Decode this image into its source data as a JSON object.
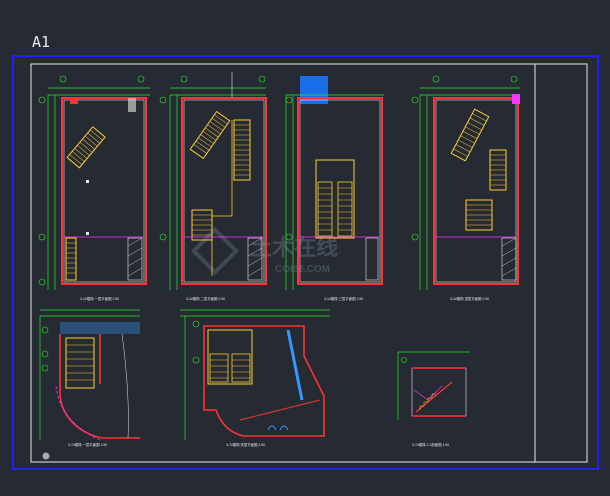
{
  "sheet": {
    "size_label": "A1"
  },
  "drawings": {
    "plan_1_caption": "3-1#楼梯 一层平面图 1:50",
    "plan_2_caption": "3-1#楼梯 二层平面图 1:50",
    "plan_3_caption": "3-1#楼梯 三层平面图 1:50",
    "plan_4_caption": "3-1#楼梯 顶层平面图 1:50",
    "plan_5_caption": "3-7#楼梯 一层平面图 1:50",
    "plan_6_caption": "3-7#楼梯 夹层平面图 1:50",
    "plan_7_caption": "3-7#楼梯 1-1剖面图 1:50"
  },
  "watermark": {
    "text": "土木在线",
    "subtext": "COI88.COM"
  },
  "colors": {
    "frame": "#2020ff",
    "line": "#e8e8e8",
    "dim": "#22ee22",
    "wall": "#ff3333",
    "stair": "#ffcc33",
    "accent": "#3399ff",
    "magenta": "#ff33ff"
  }
}
